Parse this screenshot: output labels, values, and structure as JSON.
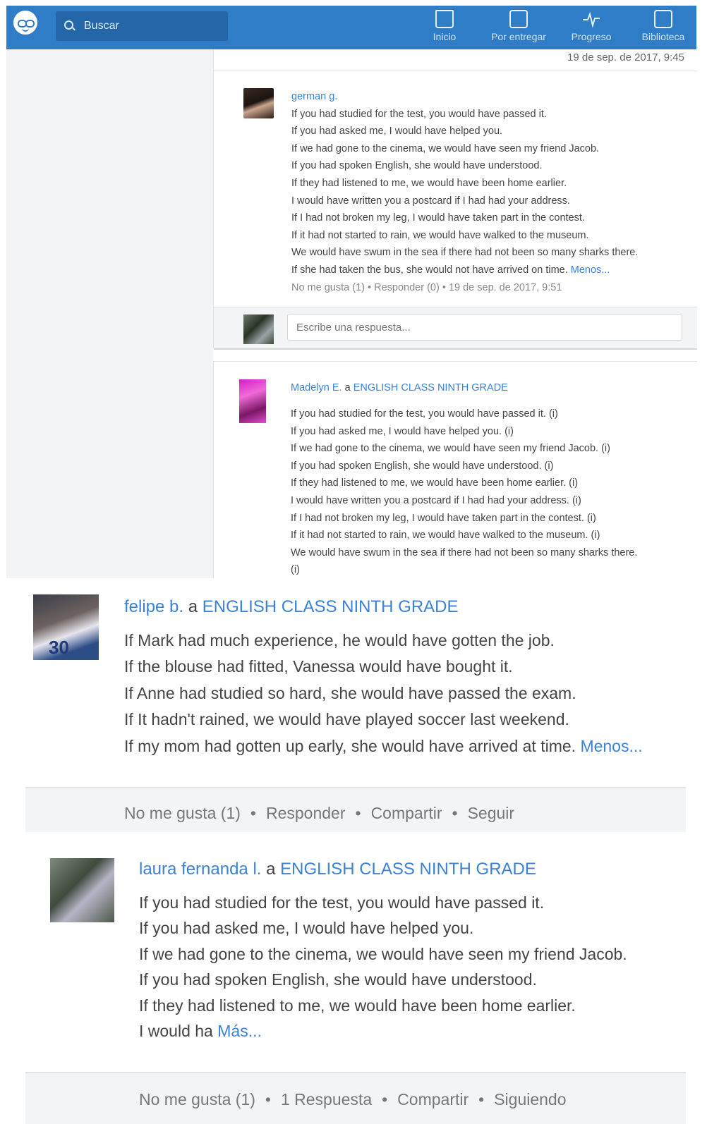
{
  "header": {
    "search_placeholder": "Buscar",
    "nav": [
      {
        "label": "Inicio",
        "icon": "home-icon"
      },
      {
        "label": "Por entregar",
        "icon": "assignment-icon"
      },
      {
        "label": "Progreso",
        "icon": "progress-icon"
      },
      {
        "label": "Biblioteca",
        "icon": "library-icon"
      }
    ]
  },
  "card1": {
    "prev_timestamp": "19 de sep. de 2017, 9:45",
    "reply": {
      "author": "german g.",
      "lines": [
        "If you had studied for the test, you would have passed it.",
        "If you had asked me, I would have helped you.",
        "If we had gone to the cinema, we would have seen my friend Jacob.",
        "If you had spoken English, she would have understood.",
        "If they had listened to me, we would have been home earlier.",
        "I would have written you a postcard if I had had your address.",
        "If I had not broken my leg, I would have taken part in the contest.",
        "If it had not started to rain, we would have walked to the museum.",
        "We would have swum in the sea if there had not been so many sharks there."
      ],
      "last_line": "If she had taken the bus, she would not have arrived on time.",
      "less": "Menos...",
      "dislike": "No me gusta (1)",
      "respond": "Responder (0)",
      "timestamp": "19 de sep. de 2017, 9:51"
    },
    "reply_placeholder": "Escribe una respuesta..."
  },
  "card2": {
    "author": "Madelyn E.",
    "to": "a",
    "group": "ENGLISH CLASS NINTH GRADE",
    "lines": [
      "If you had studied for the test, you would have passed it. (i)",
      "If you had asked me, I would have helped you. (i)",
      "If we had gone to the cinema, we would have seen my friend Jacob. (i)",
      "If you had spoken English, she would have understood. (i)",
      "If they had listened to me, we would have been home earlier. (i)",
      "I would have written you a postcard if I had had your address. (i)",
      "If I had not broken my leg, I would have taken part in the contest. (i)",
      "If it had not started to rain, we would have walked to the museum. (i)",
      "We would have swum in the sea if there had not been so many sharks there.",
      "(i)"
    ]
  },
  "post3": {
    "author": "felipe b.",
    "to": "a",
    "group": "ENGLISH CLASS NINTH GRADE",
    "lines": [
      "If Mark had much experience, he would have gotten the job.",
      "If the blouse had fitted, Vanessa would have bought it.",
      "If Anne had studied so hard, she would have passed the exam.",
      "If It hadn't rained, we would have played soccer last weekend."
    ],
    "last_line": "If my mom had gotten up early, she would have arrived at time.",
    "less": "Menos...",
    "actions": [
      "No me gusta (1)",
      "Responder",
      "Compartir",
      "Seguir"
    ]
  },
  "post4": {
    "author": "laura fernanda l.",
    "to": "a",
    "group": "ENGLISH CLASS NINTH GRADE",
    "lines": [
      "If you had studied for the test, you would have passed it.",
      "If you had asked me, I would have helped you.",
      "If we had gone to the cinema, we would have seen my friend Jacob.",
      "If you had spoken English, she would have understood.",
      "If they had listened to me, we would have been home earlier."
    ],
    "last_line": "I would ha",
    "more": "Más...",
    "actions": [
      "No me gusta (1)",
      "1 Respuesta",
      "Compartir",
      "Siguiendo"
    ]
  }
}
